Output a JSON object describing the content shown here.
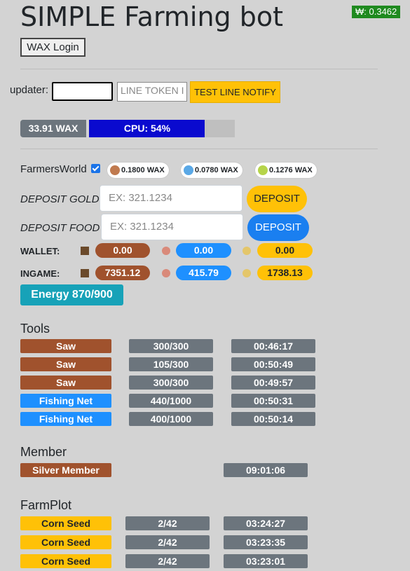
{
  "header": {
    "title": "SIMPLE Farming bot",
    "wax_price": "₩: 0.3462",
    "login_label": "WAX Login"
  },
  "updater": {
    "label": "updater:",
    "token_placeholder": "LINE TOKEN I",
    "notify_label": "TEST LINE NOTIFY"
  },
  "account": {
    "wax_balance": "33.91 WAX",
    "cpu_label": "CPU: 54%",
    "cpu_percent": 54
  },
  "farmersworld": {
    "label": "FarmersWorld",
    "prices": [
      "0.1800 WAX",
      "0.0780 WAX",
      "0.1276 WAX"
    ],
    "deposit_gold": {
      "label": "DEPOSIT GOLD",
      "placeholder": "EX: 321.1234",
      "button": "DEPOSIT"
    },
    "deposit_food": {
      "label": "DEPOSIT FOOD",
      "placeholder": "EX: 321.1234",
      "button": "DEPOSIT"
    },
    "wallet": {
      "label": "WALLET:",
      "wood": "0.00",
      "food": "0.00",
      "gold": "0.00"
    },
    "ingame": {
      "label": "INGAME:",
      "wood": "7351.12",
      "food": "415.79",
      "gold": "1738.13"
    },
    "energy": "Energy 870/900"
  },
  "tools": {
    "title": "Tools",
    "rows": [
      {
        "name": "Saw",
        "durability": "300/300",
        "timer": "00:46:17",
        "color": "brown"
      },
      {
        "name": "Saw",
        "durability": "105/300",
        "timer": "00:50:49",
        "color": "brown"
      },
      {
        "name": "Saw",
        "durability": "300/300",
        "timer": "00:49:57",
        "color": "brown"
      },
      {
        "name": "Fishing Net",
        "durability": "440/1000",
        "timer": "00:50:31",
        "color": "blue"
      },
      {
        "name": "Fishing Net",
        "durability": "400/1000",
        "timer": "00:50:14",
        "color": "blue"
      }
    ]
  },
  "member": {
    "title": "Member",
    "name": "Silver Member",
    "timer": "09:01:06"
  },
  "farmplot": {
    "title": "FarmPlot",
    "rows": [
      {
        "name": "Corn Seed",
        "progress": "2/42",
        "timer": "03:24:27"
      },
      {
        "name": "Corn Seed",
        "progress": "2/42",
        "timer": "03:23:35"
      },
      {
        "name": "Corn Seed",
        "progress": "2/42",
        "timer": "03:23:01"
      }
    ]
  },
  "colors": {
    "brown": "#a0522d",
    "blue": "#1e90ff",
    "gray": "#6c757d",
    "gold": "#ffc107",
    "teal": "#17a2b8",
    "cpu": "#0a0acf"
  }
}
